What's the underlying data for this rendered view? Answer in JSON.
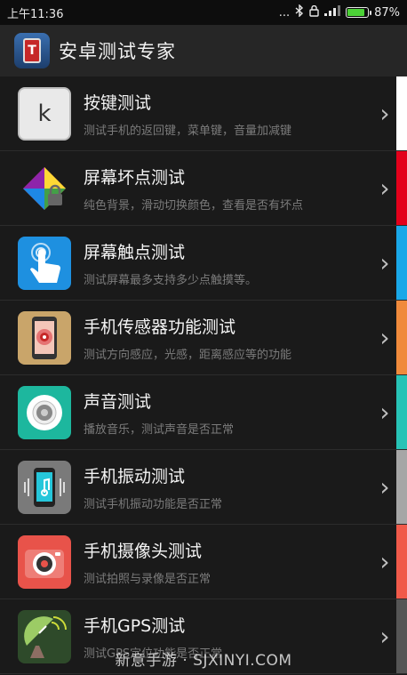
{
  "status": {
    "time": "上午11:36",
    "dots": "...",
    "battery": "87%",
    "battery_fraction": 0.87
  },
  "app": {
    "title": "安卓测试专家",
    "logo_letter": "T"
  },
  "items": [
    {
      "title": "按键测试",
      "subtitle": "测试手机的返回键，菜单键，音量加减键",
      "icon": "keyboard-key-icon",
      "key_letter": "k",
      "strip": "#ffffff"
    },
    {
      "title": "屏幕坏点测试",
      "subtitle": "纯色背景，滑动切换颜色，查看是否有坏点",
      "icon": "color-diamond-icon",
      "strip": "#e3001b"
    },
    {
      "title": "屏幕触点测试",
      "subtitle": "测试屏幕最多支持多少点触摸等。",
      "icon": "touch-hand-icon",
      "strip": "#1aa8e8"
    },
    {
      "title": "手机传感器功能测试",
      "subtitle": "测试方向感应，光感，距离感应等的功能",
      "icon": "sensor-phone-icon",
      "strip": "#f08a3c"
    },
    {
      "title": "声音测试",
      "subtitle": "播放音乐，测试声音是否正常",
      "icon": "speaker-icon",
      "strip": "#27c3b6"
    },
    {
      "title": "手机振动测试",
      "subtitle": "测试手机振动功能是否正常",
      "icon": "vibrate-phone-icon",
      "strip": "#a6a6a6"
    },
    {
      "title": "手机摄像头测试",
      "subtitle": "测试拍照与录像是否正常",
      "icon": "camera-icon",
      "strip": "#f05a4a"
    },
    {
      "title": "手机GPS测试",
      "subtitle": "测试GPS定位功能是否正常",
      "icon": "satellite-dish-icon",
      "strip": "#555555"
    }
  ],
  "watermark": "新意手游 · SJXINYI.COM"
}
